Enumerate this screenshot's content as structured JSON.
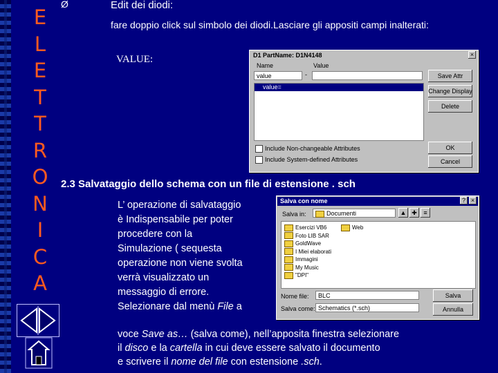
{
  "side_letters": [
    "E",
    "L",
    "E",
    "T",
    "T",
    "R",
    "O",
    "N",
    "I",
    "C",
    "A"
  ],
  "section1": {
    "bullet": "Ø",
    "heading": "Edit dei diodi:",
    "instruction": "fare doppio click sul simbolo dei diodi.Lasciare gli appositi  campi inalterati:",
    "value_label": "VALUE:"
  },
  "edit_dialog": {
    "title": "D1  PartName: D1N4148",
    "name_label": "Name",
    "value_label": "Value",
    "name_field": "value",
    "value_field": "-",
    "list_item": "value=",
    "save_attr": "Save Attr",
    "change_display": "Change Display",
    "delete": "Delete",
    "ok": "OK",
    "cancel": "Cancel",
    "check1": "Include Non-changeable Attributes",
    "check2": "Include System-defined Attributes",
    "close": "×"
  },
  "section2": {
    "heading": "2.3 Salvataggio dello schema con un file di estensione . sch",
    "para_lines": [
      "L’ operazione di salvataggio",
      "è  Indispensabile per  poter",
      "procedere         con         la",
      "Simulazione      (  sequesta",
      "operazione non viene svolta",
      "verrà      visualizzato      un",
      "messaggio  di  errore."
    ],
    "line_sel_a": "Selezionare dal menù ",
    "line_sel_file": "File",
    "line_sel_b": " a",
    "line2_a": "voce ",
    "line2_saveas": "Save as…",
    "line2_b": " (salva come), nell’apposita finestra selezionare",
    "line3_a": "il ",
    "line3_disco": "disco",
    "line3_b": " e la ",
    "line3_cartella": "cartella",
    "line3_c": " in cui  deve  essere  salvato  il documento",
    "line4_a": "e scrivere il ",
    "line4_nome": "nome del file",
    "line4_b": " con estensione ",
    "line4_sch": ".sch",
    "line4_c": "."
  },
  "save_dialog": {
    "title": "Salva con nome",
    "help": "?",
    "close": "×",
    "save_in_label": "Salva in:",
    "save_in_value": "Documenti",
    "folders_left": [
      "Esercizi VB6",
      "Foto LIB SAR",
      "GoldWave",
      "I Miei elaborati",
      "Immagini",
      "My Music",
      "\"DPI\""
    ],
    "folders_right": [
      "Web"
    ],
    "filename_label": "Nome file:",
    "filename_value": "BLC",
    "filetype_label": "Salva come:",
    "filetype_value": "Schematics (*.sch)",
    "save_btn": "Salva",
    "cancel_btn": "Annulla"
  }
}
